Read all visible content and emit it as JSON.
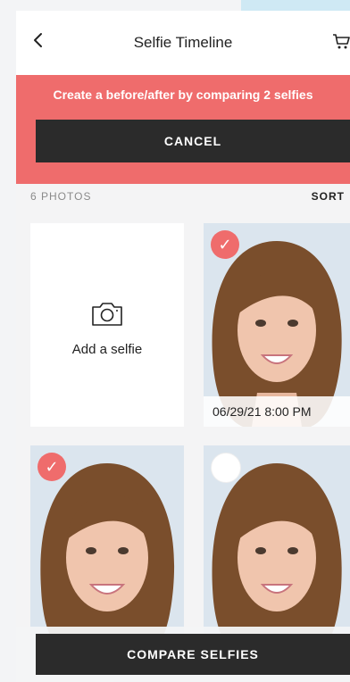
{
  "header": {
    "title": "Selfie Timeline",
    "back_icon": "chevron-left-icon",
    "cart_icon": "cart-icon"
  },
  "banner": {
    "message": "Create a before/after by comparing 2 selfies",
    "cancel_label": "CANCEL",
    "color": "#ef6c6c"
  },
  "gallery": {
    "count_label": "6 PHOTOS",
    "sort_label": "SORT",
    "add_tile": {
      "label": "Add a selfie",
      "icon": "camera-icon"
    },
    "photos": [
      {
        "timestamp": "06/29/21 8:00 PM",
        "selected": true
      },
      {
        "timestamp": "",
        "selected": true
      },
      {
        "timestamp": "",
        "selected": false
      }
    ]
  },
  "footer": {
    "compare_label": "COMPARE SELFIES"
  }
}
